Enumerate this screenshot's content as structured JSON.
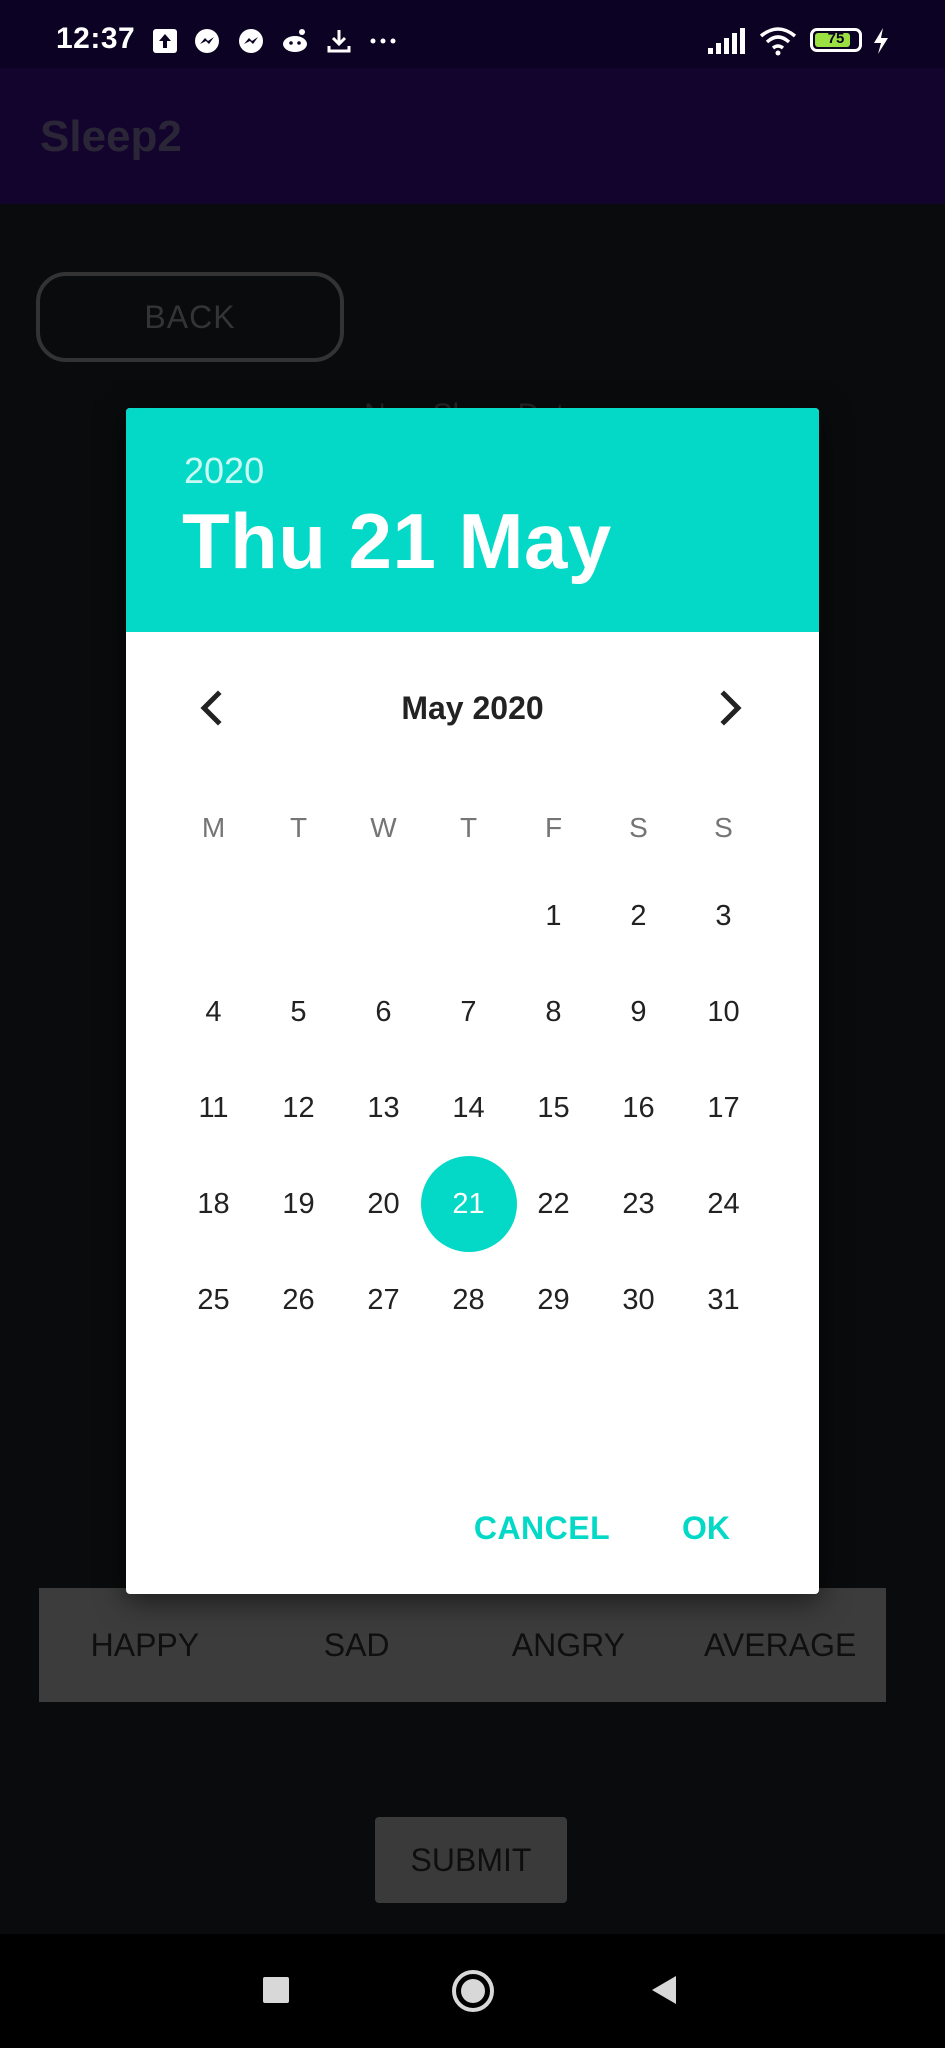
{
  "status_bar": {
    "time": "12:37",
    "battery": "75",
    "left_icons": [
      "upload-icon",
      "messenger-icon",
      "messenger-icon",
      "reddit-icon",
      "download-icon",
      "more-icon"
    ],
    "right_icons": [
      "signal-icon",
      "wifi-icon",
      "battery-icon",
      "charging-icon"
    ]
  },
  "app_bar": {
    "title": "Sleep2"
  },
  "main": {
    "back_label": "BACK",
    "sleep_date_label": "New Sleep Date",
    "moods": [
      "HAPPY",
      "SAD",
      "ANGRY",
      "AVERAGE"
    ],
    "submit_label": "SUBMIT"
  },
  "date_picker": {
    "header_year": "2020",
    "header_date": "Thu 21 May",
    "month_label": "May 2020",
    "weekdays": [
      "M",
      "T",
      "W",
      "T",
      "F",
      "S",
      "S"
    ],
    "first_weekday_index": 4,
    "days_in_month": 31,
    "selected_day": 21,
    "cancel_label": "CANCEL",
    "ok_label": "OK"
  },
  "colors": {
    "accent": "#03d9c6",
    "app_bar": "#220950",
    "status_bar": "#0c0224",
    "background": "#131416"
  },
  "nav_bar": {
    "icons": [
      "recents-icon",
      "home-icon",
      "back-icon"
    ]
  }
}
